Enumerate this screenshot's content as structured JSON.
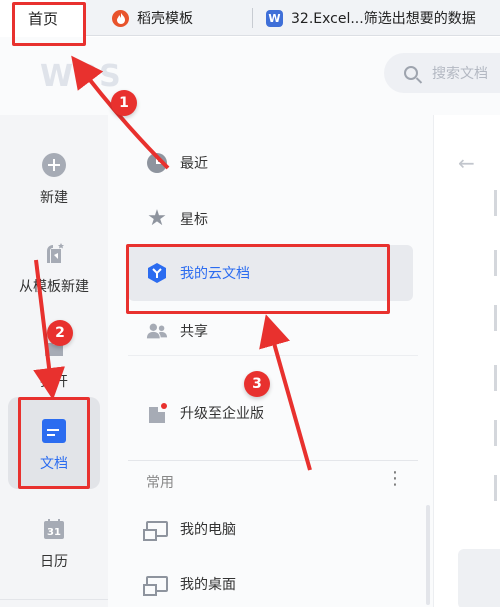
{
  "tabs": [
    {
      "label": "首页",
      "icon": "",
      "active": true
    },
    {
      "label": "稻壳模板",
      "icon": "daoke-icon",
      "active": false
    },
    {
      "label": "32.Excel...筛选出想要的数据",
      "icon": "wps-writer-icon",
      "active": false
    }
  ],
  "header": {
    "logo": "WPS",
    "search_placeholder": "搜索文档"
  },
  "sidebar": {
    "items": [
      {
        "label": "新建",
        "icon": "plus-circle-icon"
      },
      {
        "label": "从模板新建",
        "icon": "template-icon"
      },
      {
        "label": "打开",
        "icon": "folder-open-icon"
      },
      {
        "label": "文档",
        "icon": "document-icon",
        "active": true
      },
      {
        "label": "日历",
        "icon": "calendar-icon"
      }
    ],
    "calendar_day": "31"
  },
  "nav": {
    "items": [
      {
        "label": "最近",
        "icon": "clock-icon"
      },
      {
        "label": "星标",
        "icon": "star-icon"
      },
      {
        "label": "我的云文档",
        "icon": "cloud-docs-icon",
        "active": true
      },
      {
        "label": "共享",
        "icon": "people-icon"
      },
      {
        "label": "升级至企业版",
        "icon": "enterprise-icon"
      }
    ],
    "common_label": "常用",
    "more": "⋮",
    "common_items": [
      {
        "label": "我的电脑",
        "icon": "computer-icon"
      },
      {
        "label": "我的桌面",
        "icon": "desktop-icon"
      }
    ]
  },
  "annotations": {
    "badges": [
      "1",
      "2",
      "3"
    ],
    "color": "#e8312e"
  },
  "colors": {
    "accent": "#2b6cf0",
    "annotation_red": "#e8312e"
  }
}
